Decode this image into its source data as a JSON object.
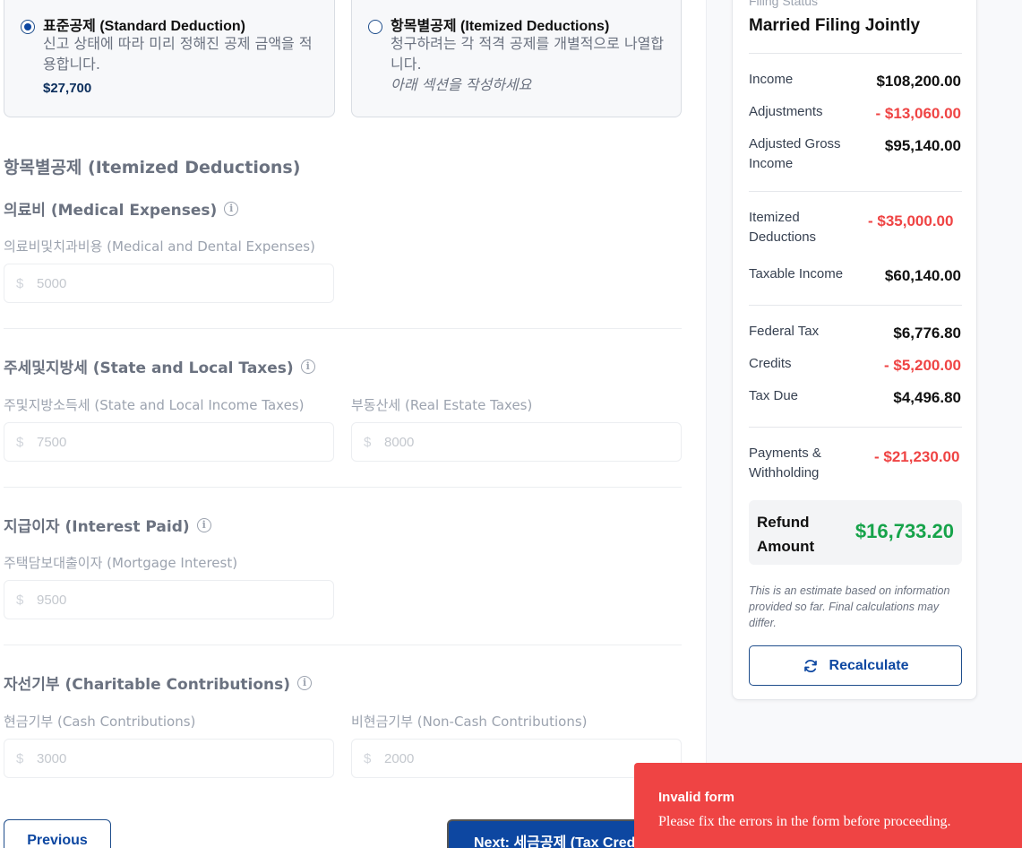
{
  "deduction_options": {
    "standard": {
      "title": "표준공제 (Standard Deduction)",
      "description": "신고 상태에 따라 미리 정해진 공제 금액을 적용합니다.",
      "amount": "$27,700",
      "selected": true
    },
    "itemized": {
      "title": "항목별공제 (Itemized Deductions)",
      "description": "청구하려는 각 적격 공제를 개별적으로 나열합니다.",
      "note": "아래 섹션을 작성하세요",
      "selected": false
    }
  },
  "itemized_section": {
    "heading": "항목별공제 (Itemized Deductions)",
    "medical": {
      "title": "의료비 (Medical Expenses)",
      "field_label": "의료비및치과비용 (Medical and Dental Expenses)",
      "currency": "$",
      "placeholder": "5000"
    },
    "state_local": {
      "title": "주세및지방세 (State and Local Taxes)",
      "income_label": "주및지방소득세 (State and Local Income Taxes)",
      "income_placeholder": "7500",
      "property_label": "부동산세 (Real Estate Taxes)",
      "property_placeholder": "8000",
      "currency": "$"
    },
    "interest": {
      "title": "지급이자 (Interest Paid)",
      "field_label": "주택담보대출이자 (Mortgage Interest)",
      "currency": "$",
      "placeholder": "9500"
    },
    "charity": {
      "title": "자선기부 (Charitable Contributions)",
      "cash_label": "현금기부 (Cash Contributions)",
      "cash_placeholder": "3000",
      "noncash_label": "비현금기부 (Non-Cash Contributions)",
      "noncash_placeholder": "2000",
      "currency": "$"
    },
    "info_icon_glyph": "i"
  },
  "navigation": {
    "previous_label": "Previous",
    "next_label": "Next: 세금공제 (Tax Credits)"
  },
  "summary": {
    "filing_status_label": "Filing Status",
    "filing_status": "Married Filing Jointly",
    "income_label": "Income",
    "income": "$108,200.00",
    "adjustments_label": "Adjustments",
    "adjustments": "- $13,060.00",
    "agi_label": "Adjusted Gross Income",
    "agi": "$95,140.00",
    "itemized_label": "Itemized Deductions",
    "itemized": "- $35,000.00",
    "taxable_label": "Taxable Income",
    "taxable": "$60,140.00",
    "federal_tax_label": "Federal Tax",
    "federal_tax": "$6,776.80",
    "credits_label": "Credits",
    "credits": "- $5,200.00",
    "tax_due_label": "Tax Due",
    "tax_due": "$4,496.80",
    "payments_label": "Payments & Withholding",
    "payments": "- $21,230.00",
    "refund_label": "Refund Amount",
    "refund": "$16,733.20",
    "disclaimer": "This is an estimate based on information provided so far. Final calculations may differ.",
    "recalculate_label": "Recalculate"
  },
  "toast": {
    "title": "Invalid form",
    "message": "Please fix the errors in the form before proceeding."
  },
  "colors": {
    "primary": "#0d47a1",
    "negative": "#ef4444",
    "positive": "#16a34a",
    "toast_bg": "#ef4444"
  }
}
